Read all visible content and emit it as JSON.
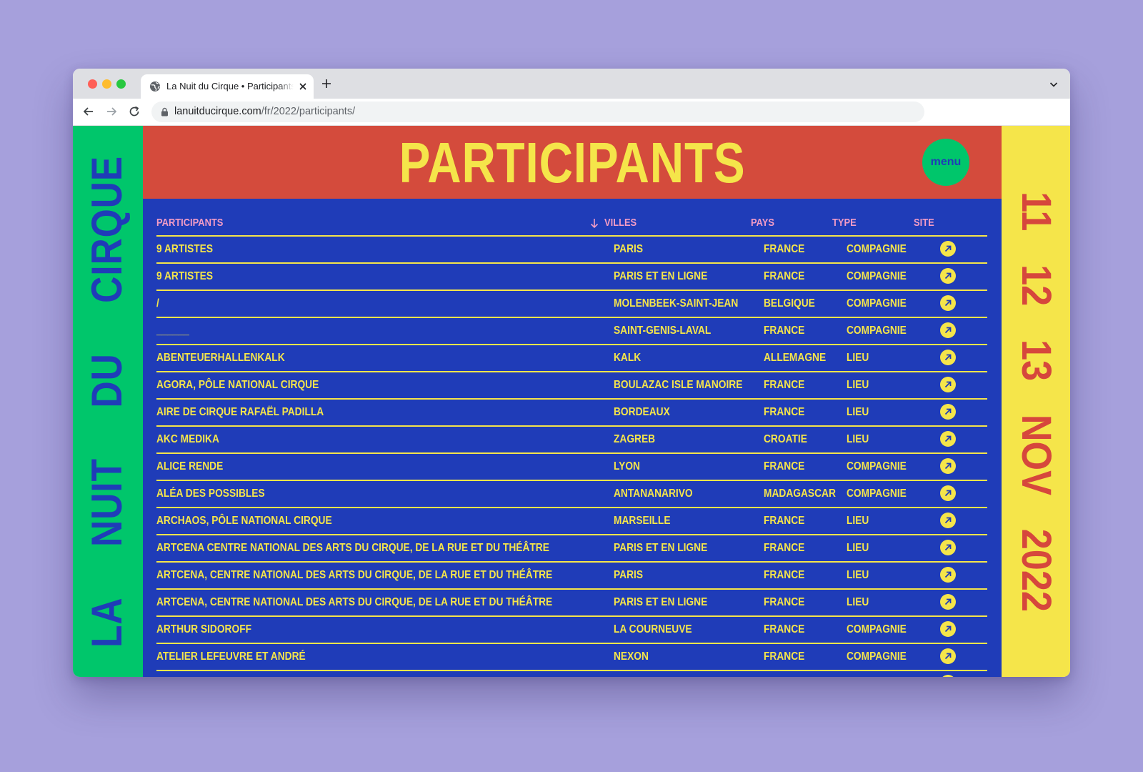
{
  "browser": {
    "tab_title": "La Nuit du Cirque • Participants",
    "url_host": "lanuitducirque.com",
    "url_path": "/fr/2022/participants/"
  },
  "branding": {
    "left_words": [
      "LA",
      "NUIT",
      "DU",
      "CIRQUE"
    ],
    "right_words": [
      "11",
      "12",
      "13",
      "NOV",
      "2022"
    ]
  },
  "header": {
    "title": "PARTICIPANTS",
    "menu_label": "menu"
  },
  "colors": {
    "left_band": "#00c66b",
    "right_band": "#f5e54a",
    "header": "#d44b3c",
    "table_bg": "#1f3cb8",
    "text_yellow": "#f5e54a",
    "header_pink": "#f29cc6"
  },
  "table": {
    "columns": [
      "PARTICIPANTS",
      "VILLES",
      "PAYS",
      "TYPE",
      "SITE"
    ],
    "sort_icon": "arrow-down-icon",
    "site_icon": "arrow-up-right-icon",
    "rows": [
      [
        "9 ARTISTES",
        "PARIS",
        "FRANCE",
        "COMPAGNIE"
      ],
      [
        "9 ARTISTES",
        "PARIS ET EN LIGNE",
        "FRANCE",
        "COMPAGNIE"
      ],
      [
        "/",
        "MOLENBEEK-SAINT-JEAN",
        "BELGIQUE",
        "COMPAGNIE"
      ],
      [
        "______",
        "SAINT-GENIS-LAVAL",
        "FRANCE",
        "COMPAGNIE"
      ],
      [
        "ABENTEUERHALLENKALK",
        "KALK",
        "ALLEMAGNE",
        "LIEU"
      ],
      [
        "AGORA, PÔLE NATIONAL CIRQUE",
        "BOULAZAC ISLE MANOIRE",
        "FRANCE",
        "LIEU"
      ],
      [
        "AIRE DE CIRQUE RAFAËL PADILLA",
        "BORDEAUX",
        "FRANCE",
        "LIEU"
      ],
      [
        "AKC MEDIKA",
        "ZAGREB",
        "CROATIE",
        "LIEU"
      ],
      [
        "ALICE RENDE",
        "LYON",
        "FRANCE",
        "COMPAGNIE"
      ],
      [
        "ALÉA DES POSSIBLES",
        "ANTANANARIVO",
        "MADAGASCAR",
        "COMPAGNIE"
      ],
      [
        "ARCHAOS, PÔLE NATIONAL CIRQUE",
        "MARSEILLE",
        "FRANCE",
        "LIEU"
      ],
      [
        "ARTCENA CENTRE NATIONAL DES ARTS DU CIRQUE, DE LA RUE ET DU THÉÂTRE",
        "PARIS ET EN LIGNE",
        "FRANCE",
        "LIEU"
      ],
      [
        "ARTCENA, CENTRE NATIONAL DES ARTS DU CIRQUE, DE LA RUE ET DU THÉÂTRE",
        "PARIS",
        "FRANCE",
        "LIEU"
      ],
      [
        "ARTCENA, CENTRE NATIONAL DES ARTS DU CIRQUE, DE LA RUE ET DU THÉÂTRE",
        "PARIS ET EN LIGNE",
        "FRANCE",
        "LIEU"
      ],
      [
        "ARTHUR SIDOROFF",
        "LA COURNEUVE",
        "FRANCE",
        "COMPAGNIE"
      ],
      [
        "ATELIER LEFEUVRE ET ANDRÉ",
        "NEXON",
        "FRANCE",
        "COMPAGNIE"
      ],
      [
        "",
        "",
        "",
        ""
      ]
    ]
  }
}
